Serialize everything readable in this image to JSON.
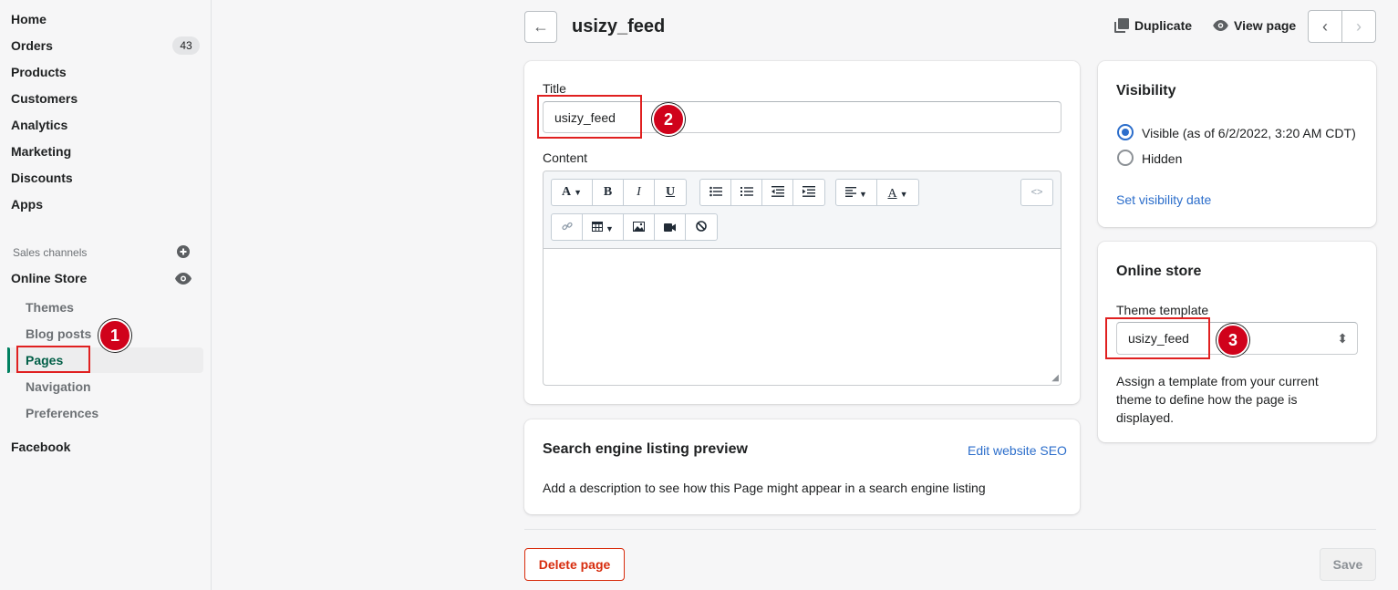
{
  "sidebar": {
    "items": [
      {
        "label": "Home"
      },
      {
        "label": "Orders",
        "badge": "43"
      },
      {
        "label": "Products"
      },
      {
        "label": "Customers"
      },
      {
        "label": "Analytics"
      },
      {
        "label": "Marketing"
      },
      {
        "label": "Discounts"
      },
      {
        "label": "Apps"
      }
    ],
    "sales_channels_label": "Sales channels",
    "online_store_label": "Online Store",
    "online_store_sub": [
      {
        "label": "Themes"
      },
      {
        "label": "Blog posts"
      },
      {
        "label": "Pages"
      },
      {
        "label": "Navigation"
      },
      {
        "label": "Preferences"
      }
    ],
    "facebook_label": "Facebook"
  },
  "header": {
    "title": "usizy_feed",
    "duplicate_label": "Duplicate",
    "view_page_label": "View page",
    "back_icon": "←",
    "prev_icon": "‹",
    "next_icon": "›"
  },
  "main": {
    "title_label": "Title",
    "title_value": "usizy_feed",
    "content_label": "Content"
  },
  "seo": {
    "title": "Search engine listing preview",
    "edit_link": "Edit website SEO",
    "description": "Add a description to see how this Page might appear in a search engine listing"
  },
  "visibility": {
    "title": "Visibility",
    "visible_label": "Visible (as of 6/2/2022, 3:20 AM CDT)",
    "hidden_label": "Hidden",
    "set_date_link": "Set visibility date"
  },
  "online_store": {
    "title": "Online store",
    "theme_template_label": "Theme template",
    "theme_template_value": "usizy_feed",
    "help_line1": "Assign a template from your current",
    "help_line2": "theme to define how the page is",
    "help_line3": "displayed."
  },
  "footer": {
    "delete_label": "Delete page",
    "save_label": "Save"
  },
  "annotations": [
    "1",
    "2",
    "3"
  ],
  "colors": {
    "accent_green": "#008060",
    "link_blue": "#2c6ecb",
    "danger_red": "#d72c0d",
    "annotation_red": "#e02020"
  }
}
